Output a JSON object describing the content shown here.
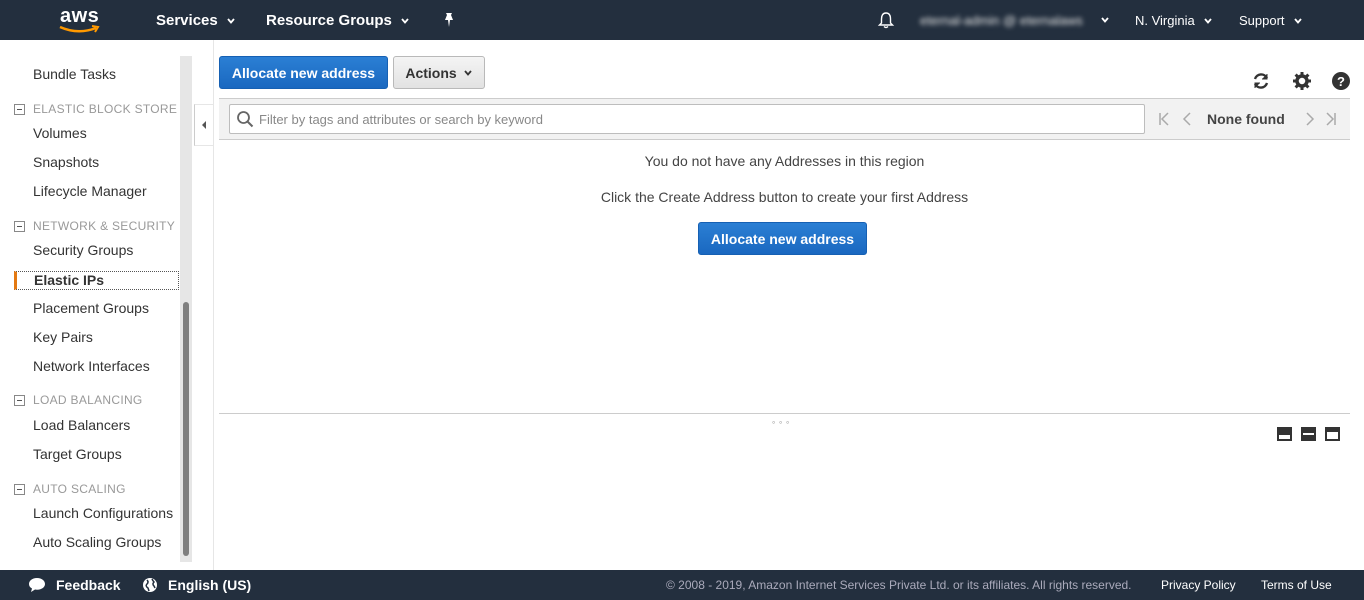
{
  "topnav": {
    "logo_text": "aws",
    "services_label": "Services",
    "resource_groups_label": "Resource Groups",
    "account_label": "eternal-admin @ eternalaws",
    "region_label": "N. Virginia",
    "support_label": "Support"
  },
  "sidebar": {
    "bundle_tasks": "Bundle Tasks",
    "sections": {
      "ebs": "ELASTIC BLOCK STORE",
      "network": "NETWORK & SECURITY",
      "load_balancing": "LOAD BALANCING",
      "auto_scaling": "AUTO SCALING"
    },
    "items": {
      "volumes": "Volumes",
      "snapshots": "Snapshots",
      "lifecycle_manager": "Lifecycle Manager",
      "security_groups": "Security Groups",
      "elastic_ips": "Elastic IPs",
      "placement_groups": "Placement Groups",
      "key_pairs": "Key Pairs",
      "network_interfaces": "Network Interfaces",
      "load_balancers": "Load Balancers",
      "target_groups": "Target Groups",
      "launch_configurations": "Launch Configurations",
      "auto_scaling_groups": "Auto Scaling Groups"
    },
    "active_item": "Elastic IPs"
  },
  "toolbar": {
    "allocate_label": "Allocate new address",
    "actions_label": "Actions"
  },
  "filter": {
    "placeholder": "Filter by tags and attributes or search by keyword",
    "pager_status": "None found"
  },
  "empty_state": {
    "message": "You do not have any Addresses in this region",
    "hint": "Click the Create Address button to create your first Address",
    "button_label": "Allocate new address"
  },
  "footer": {
    "feedback_label": "Feedback",
    "language_label": "English (US)",
    "copyright": "© 2008 - 2019, Amazon Internet Services Private Ltd. or its affiliates. All rights reserved.",
    "privacy_label": "Privacy Policy",
    "terms_label": "Terms of Use"
  },
  "colors": {
    "nav_bg": "#232f3e",
    "primary_button": "#1a68c0",
    "active_accent": "#e47911"
  },
  "icons": [
    "aws-logo-icon",
    "chevron-down-icon",
    "pin-icon",
    "bell-icon",
    "collapse-left-icon",
    "refresh-icon",
    "gear-icon",
    "help-icon",
    "search-icon",
    "first-page-icon",
    "prev-page-icon",
    "next-page-icon",
    "last-page-icon",
    "feedback-icon",
    "globe-icon"
  ]
}
